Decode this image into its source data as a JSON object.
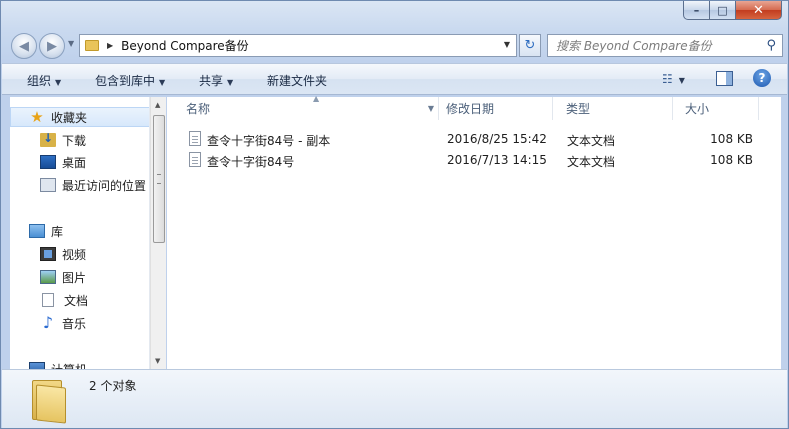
{
  "window": {
    "caption": {
      "minimize": "–",
      "maximize": "□",
      "close": "✕"
    }
  },
  "nav": {
    "back": "◀",
    "forward": "▶",
    "address": {
      "path": "Beyond Compare备份"
    },
    "refresh": "↻",
    "search": {
      "placeholder": "搜索 Beyond Compare备份"
    }
  },
  "toolbar": {
    "organize": "组织",
    "include_in_library": "包含到库中",
    "share": "共享",
    "new_folder": "新建文件夹",
    "help": "?"
  },
  "sidebar": {
    "favorites": {
      "label": "收藏夹",
      "items": [
        {
          "label": "下载",
          "icon": "download-folder-icon"
        },
        {
          "label": "桌面",
          "icon": "desktop-icon"
        },
        {
          "label": "最近访问的位置",
          "icon": "recent-places-icon"
        }
      ]
    },
    "libraries": {
      "label": "库",
      "items": [
        {
          "label": "视频",
          "icon": "video-library-icon"
        },
        {
          "label": "图片",
          "icon": "picture-library-icon"
        },
        {
          "label": "文档",
          "icon": "document-library-icon"
        },
        {
          "label": "音乐",
          "icon": "music-library-icon"
        }
      ]
    },
    "computer": {
      "label": "计算机"
    }
  },
  "columns": {
    "name": "名称",
    "date_modified": "修改日期",
    "type": "类型",
    "size": "大小"
  },
  "files": [
    {
      "name": "查令十字街84号 - 副本",
      "date": "2016/8/25 15:42",
      "type": "文本文档",
      "size": "108 KB"
    },
    {
      "name": "查令十字街84号",
      "date": "2016/7/13 14:15",
      "type": "文本文档",
      "size": "108 KB"
    }
  ],
  "status": {
    "count": "2 个对象"
  },
  "colors": {
    "accent": "#1d58b0",
    "toolbar_bg": "#dbe6f4",
    "selection": "#d7e8fb"
  }
}
